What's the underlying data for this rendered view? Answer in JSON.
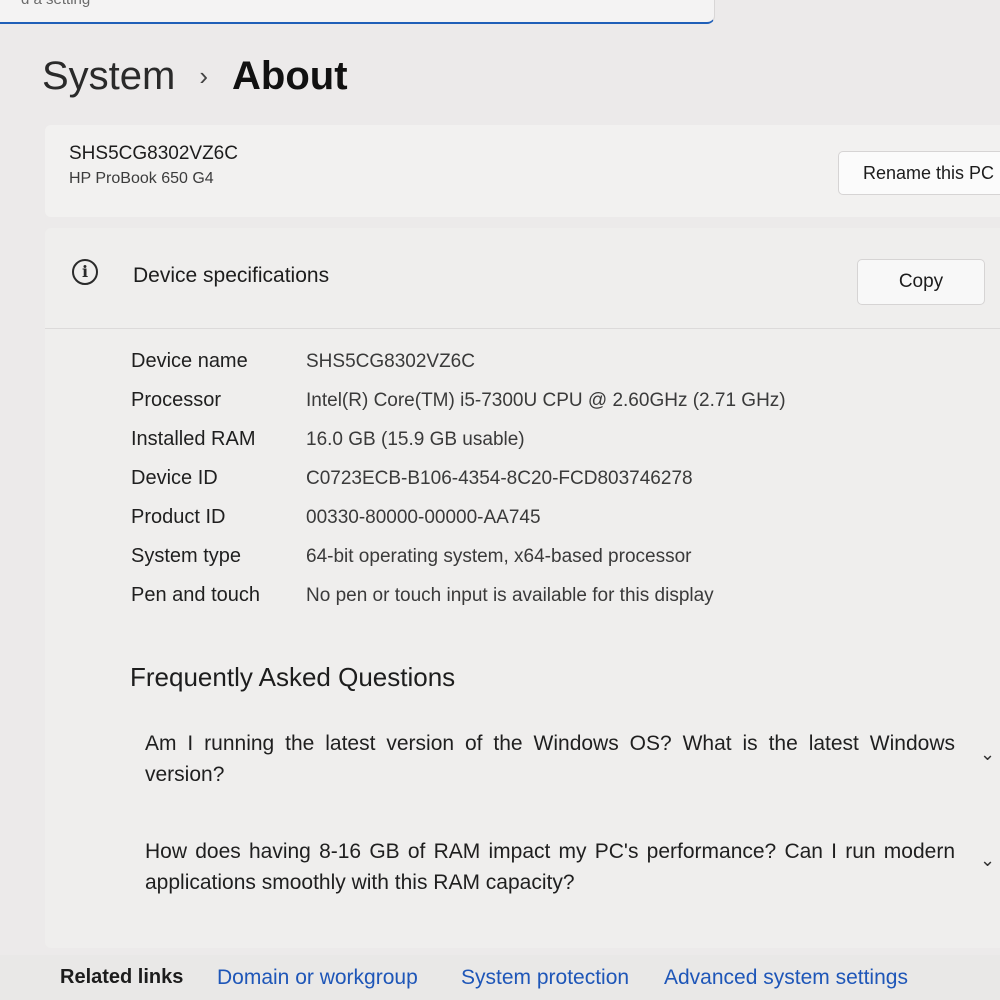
{
  "search": {
    "text": "d a setting"
  },
  "breadcrumb": {
    "parent": "System",
    "separator": "›",
    "current": "About"
  },
  "pc": {
    "name": "SHS5CG8302VZ6C",
    "model": "HP ProBook 650 G4",
    "rename_label": "Rename this PC"
  },
  "specs": {
    "title": "Device specifications",
    "copy_label": "Copy",
    "rows": [
      {
        "label": "Device name",
        "value": "SHS5CG8302VZ6C"
      },
      {
        "label": "Processor",
        "value": "Intel(R) Core(TM) i5-7300U CPU @ 2.60GHz (2.71 GHz)"
      },
      {
        "label": "Installed RAM",
        "value": "16.0 GB (15.9 GB usable)"
      },
      {
        "label": "Device ID",
        "value": "C0723ECB-B106-4354-8C20-FCD803746278"
      },
      {
        "label": "Product ID",
        "value": "00330-80000-00000-AA745"
      },
      {
        "label": "System type",
        "value": "64-bit operating system, x64-based processor"
      },
      {
        "label": "Pen and touch",
        "value": "No pen or touch input is available for this display"
      }
    ]
  },
  "faq": {
    "title": "Frequently Asked Questions",
    "items": [
      {
        "question": "Am I running the latest version of the Windows OS? What is the latest Windows version?"
      },
      {
        "question": "How does having 8-16 GB of RAM impact my PC's performance? Can I run modern applications smoothly with this RAM capacity?"
      }
    ]
  },
  "related": {
    "label": "Related links",
    "links": [
      "Domain or workgroup",
      "System protection",
      "Advanced system settings"
    ]
  },
  "icons": {
    "info": "info-icon",
    "chevron": "chevron-down-icon"
  }
}
